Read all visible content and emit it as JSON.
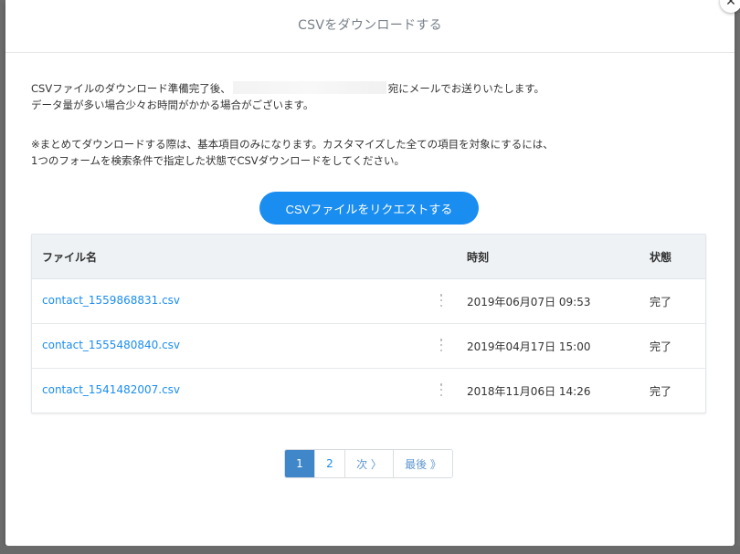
{
  "modal": {
    "title": "CSVをダウンロードする",
    "close_label": "✕"
  },
  "description": {
    "line1_before": "CSVファイルのダウンロード準備完了後、",
    "line1_after": "宛にメールでお送りいたします。",
    "line2": "データ量が多い場合少々お時間がかかる場合がございます。"
  },
  "note": {
    "line1": "※まとめてダウンロードする際は、基本項目のみになります。カスタマイズした全ての項目を対象にするには、",
    "line2": "1つのフォームを検索条件で指定した状態でCSVダウンロードをしてください。"
  },
  "request_button": {
    "label": "CSVファイルをリクエストする"
  },
  "table": {
    "headers": {
      "file_name": "ファイル名",
      "time": "時刻",
      "status": "状態"
    },
    "rows": [
      {
        "file_name": "contact_1559868831.csv",
        "time": "2019年06月07日 09:53",
        "status": "完了"
      },
      {
        "file_name": "contact_1555480840.csv",
        "time": "2019年04月17日 15:00",
        "status": "完了"
      },
      {
        "file_name": "contact_1541482007.csv",
        "time": "2018年11月06日 14:26",
        "status": "完了"
      }
    ]
  },
  "pagination": {
    "page1": "1",
    "page2": "2",
    "next": "次 〉",
    "last": "最後 》"
  },
  "colors": {
    "accent": "#1a8df0",
    "active_page": "#3f87c8",
    "header_bg": "#eef2f5"
  }
}
